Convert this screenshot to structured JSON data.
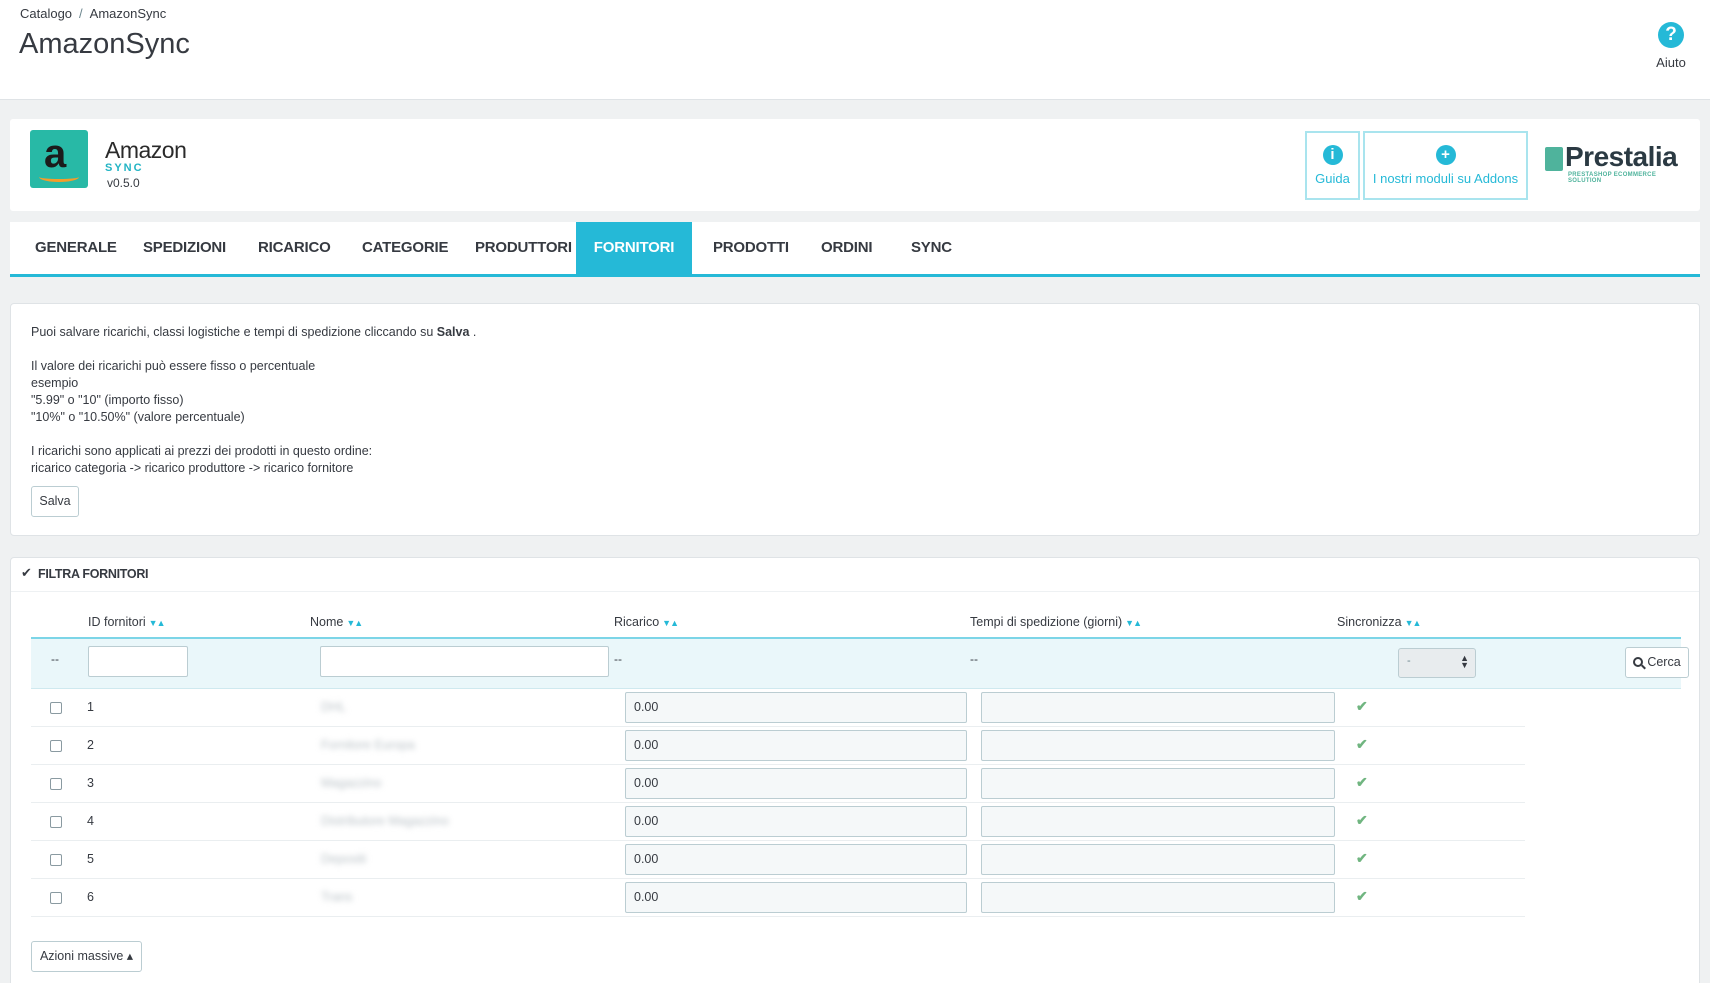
{
  "breadcrumb": {
    "parent": "Catalogo",
    "separator": "/",
    "current": "AmazonSync"
  },
  "page_title": "AmazonSync",
  "help": {
    "icon": "help-icon",
    "label": "Aiuto"
  },
  "module": {
    "name": "Amazon",
    "sub": "SYNC",
    "version": "v0.5.0",
    "logo_letter": "a",
    "buttons": [
      {
        "icon": "info-icon",
        "glyph": "i",
        "label": "Guida"
      },
      {
        "icon": "plus-circle-icon",
        "glyph": "+",
        "label": "I nostri moduli su Addons"
      }
    ],
    "brand": {
      "name": "Prestalia",
      "tagline": "PRESTASHOP ECOMMERCE SOLUTION"
    }
  },
  "tabs": [
    "GENERALE",
    "SPEDIZIONI",
    "RICARICO",
    "CATEGORIE",
    "PRODUTTORI",
    "FORNITORI",
    "PRODOTTI",
    "ORDINI",
    "SYNC"
  ],
  "active_tab": "FORNITORI",
  "info": {
    "line1_pre": "Puoi salvare ricarichi, classi logistiche e tempi di spedizione cliccando su ",
    "line1_bold": "Salva",
    "line1_post": " .",
    "line2": "Il valore dei ricarichi può essere fisso o percentuale",
    "line3": "esempio",
    "line4": "\"5.99\" o \"10\" (importo fisso)",
    "line5": "\"10%\" o \"10.50%\" (valore percentuale)",
    "line6": "I ricarichi sono applicati ai prezzi dei prodotti in questo ordine:",
    "line7": "ricarico categoria -> ricarico produttore -> ricarico fornitore",
    "save_label": "Salva"
  },
  "list": {
    "title": "FILTRA FORNITORI",
    "columns": [
      "ID fornitori",
      "Nome",
      "Ricarico",
      "Tempi di spedizione (giorni)",
      "Sincronizza"
    ],
    "sort_arrows": "▼▲",
    "filter": {
      "dash": "--",
      "select_value": "-",
      "search_label": "Cerca"
    },
    "rows": [
      {
        "id": "1",
        "name": "DHL",
        "ricarico": "0.00",
        "tempi": "",
        "sync": "✔"
      },
      {
        "id": "2",
        "name": "Fornitore Europa",
        "ricarico": "0.00",
        "tempi": "",
        "sync": "✔"
      },
      {
        "id": "3",
        "name": "Magazzino",
        "ricarico": "0.00",
        "tempi": "",
        "sync": "✔"
      },
      {
        "id": "4",
        "name": "Distributore Magazzino",
        "ricarico": "0.00",
        "tempi": "",
        "sync": "✔"
      },
      {
        "id": "5",
        "name": "Depositi",
        "ricarico": "0.00",
        "tempi": "",
        "sync": "✔"
      },
      {
        "id": "6",
        "name": "Trans",
        "ricarico": "0.00",
        "tempi": "",
        "sync": "✔"
      }
    ],
    "bulk_label": "Azioni massive ▴"
  },
  "colors": {
    "accent": "#25b9d7",
    "success": "#70b580",
    "amazon_green": "#28b9a6"
  }
}
